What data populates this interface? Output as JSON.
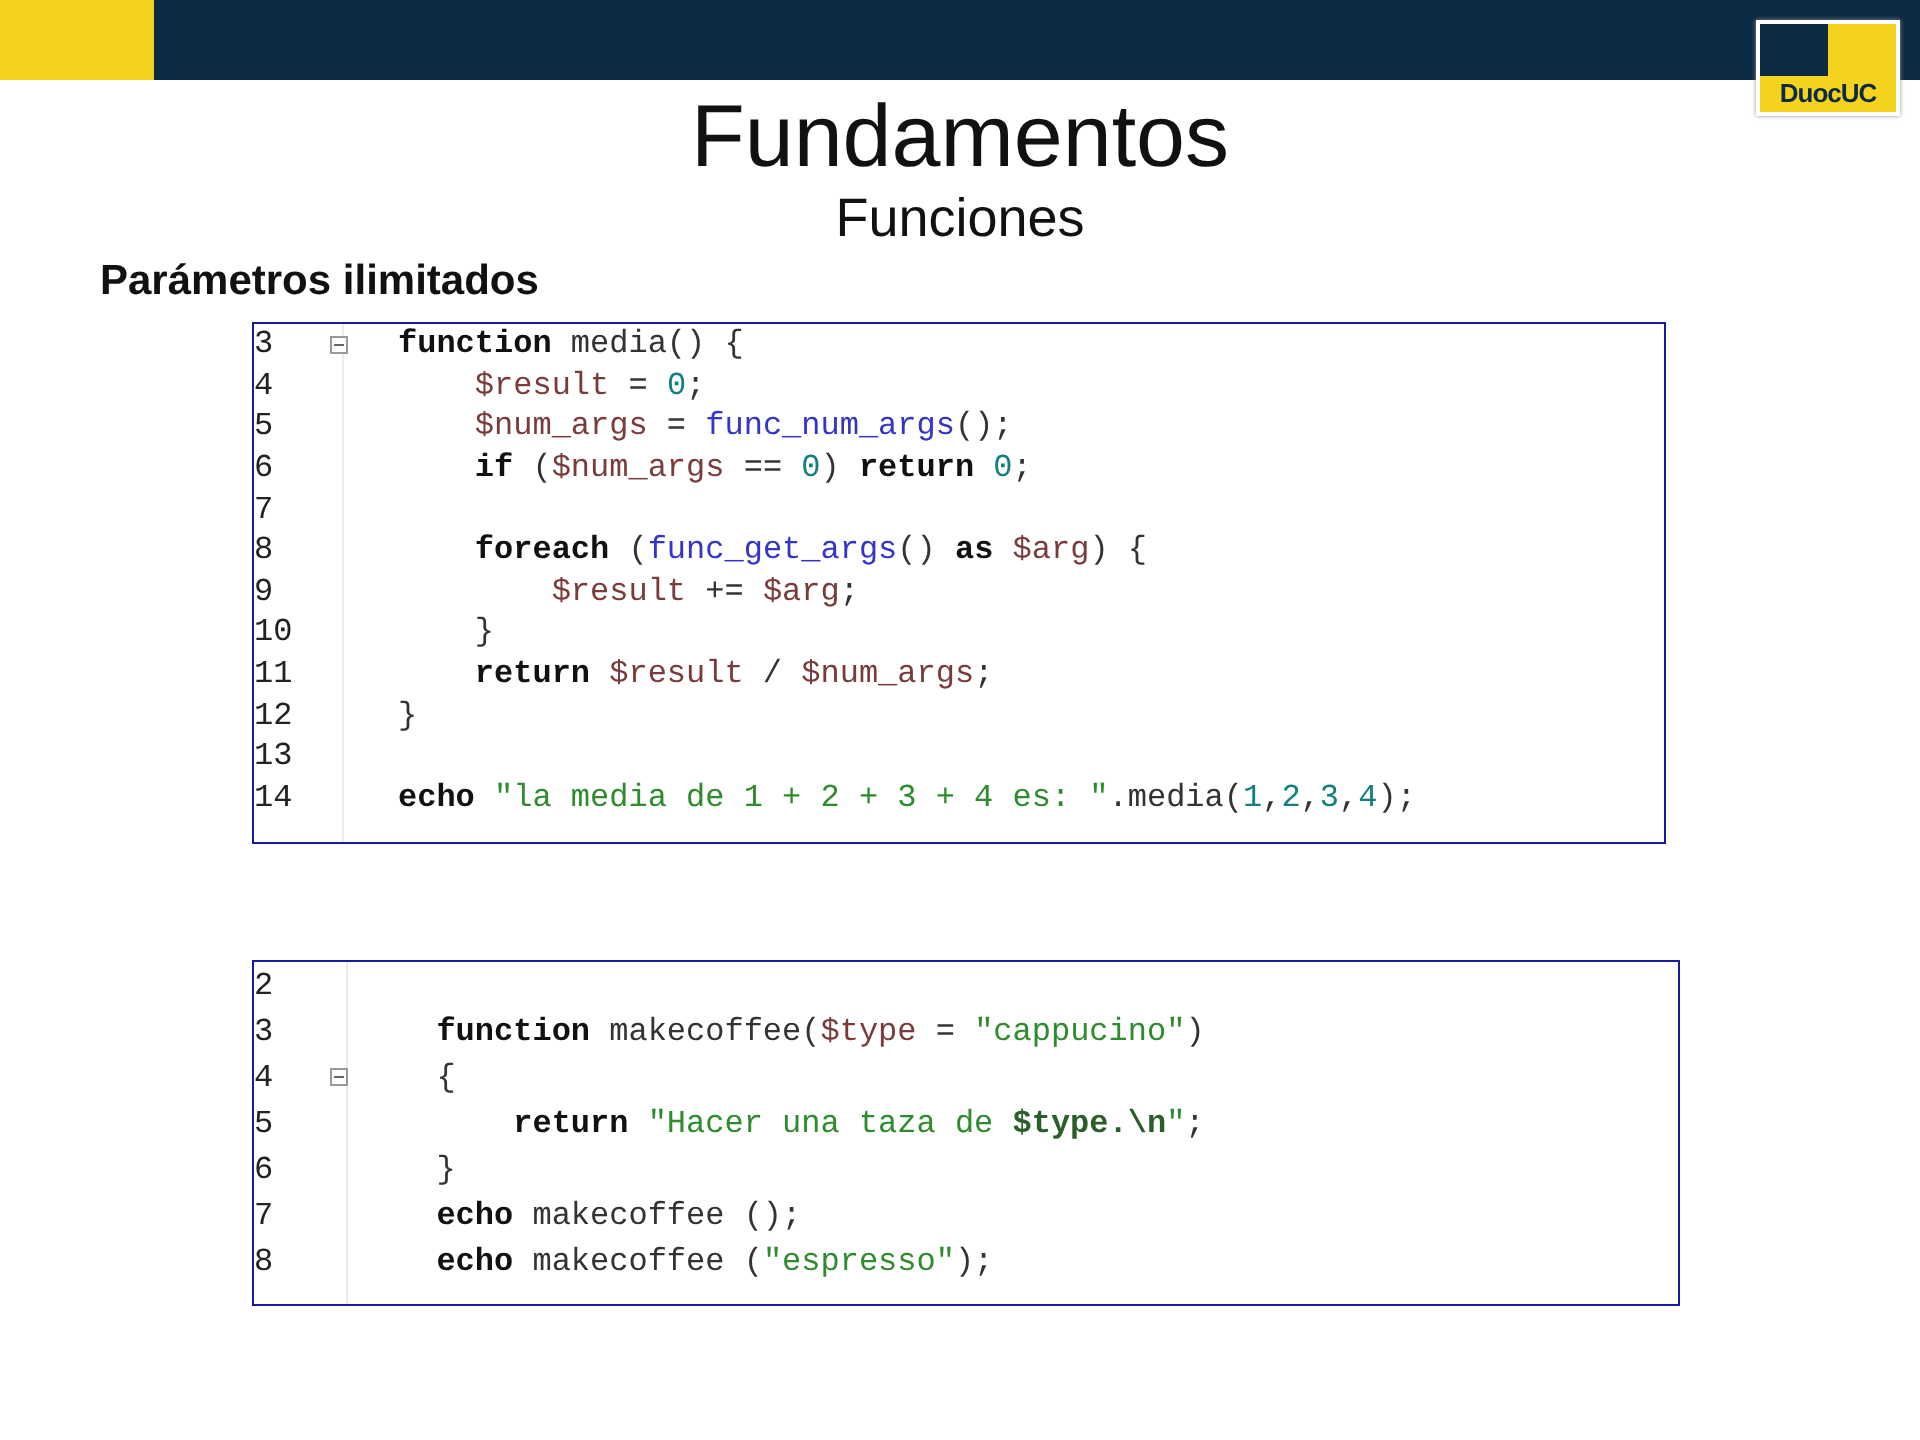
{
  "logo": {
    "text": "DuocUC"
  },
  "title": "Fundamentos",
  "subtitle": "Funciones",
  "section_heading": "Parámetros ilimitados",
  "code_blocks": [
    {
      "lines": [
        {
          "number": "3",
          "fold_marker": true,
          "tokens": [
            {
              "kind": "keyword",
              "text": "function"
            },
            {
              "kind": "plain",
              "text": " media() {"
            }
          ]
        },
        {
          "number": "4",
          "fold_marker": false,
          "tokens": [
            {
              "kind": "variable",
              "text": "    $result"
            },
            {
              "kind": "plain",
              "text": " = "
            },
            {
              "kind": "number",
              "text": "0"
            },
            {
              "kind": "plain",
              "text": ";"
            }
          ]
        },
        {
          "number": "5",
          "fold_marker": false,
          "tokens": [
            {
              "kind": "variable",
              "text": "    $num_args"
            },
            {
              "kind": "plain",
              "text": " = "
            },
            {
              "kind": "builtin",
              "text": "func_num_args"
            },
            {
              "kind": "plain",
              "text": "();"
            }
          ]
        },
        {
          "number": "6",
          "fold_marker": false,
          "tokens": [
            {
              "kind": "keyword",
              "text": "    if"
            },
            {
              "kind": "plain",
              "text": " ("
            },
            {
              "kind": "variable",
              "text": "$num_args"
            },
            {
              "kind": "plain",
              "text": " == "
            },
            {
              "kind": "number",
              "text": "0"
            },
            {
              "kind": "plain",
              "text": ") "
            },
            {
              "kind": "keyword",
              "text": "return"
            },
            {
              "kind": "number",
              "text": " 0"
            },
            {
              "kind": "plain",
              "text": ";"
            }
          ]
        },
        {
          "number": "7",
          "fold_marker": false
        },
        {
          "number": "8",
          "fold_marker": false,
          "tokens": [
            {
              "kind": "keyword",
              "text": "    foreach"
            },
            {
              "kind": "plain",
              "text": " ("
            },
            {
              "kind": "builtin",
              "text": "func_get_args"
            },
            {
              "kind": "plain",
              "text": "() "
            },
            {
              "kind": "keyword",
              "text": "as"
            },
            {
              "kind": "variable",
              "text": " $arg"
            },
            {
              "kind": "plain",
              "text": ") {"
            }
          ]
        },
        {
          "number": "9",
          "fold_marker": false,
          "tokens": [
            {
              "kind": "variable",
              "text": "        $result"
            },
            {
              "kind": "plain",
              "text": " += "
            },
            {
              "kind": "variable",
              "text": "$arg"
            },
            {
              "kind": "plain",
              "text": ";"
            }
          ]
        },
        {
          "number": "10",
          "fold_marker": false,
          "tokens": [
            {
              "kind": "plain",
              "text": "    }"
            }
          ]
        },
        {
          "number": "11",
          "fold_marker": false,
          "tokens": [
            {
              "kind": "keyword",
              "text": "    return"
            },
            {
              "kind": "variable",
              "text": " $result"
            },
            {
              "kind": "plain",
              "text": " / "
            },
            {
              "kind": "variable",
              "text": "$num_args"
            },
            {
              "kind": "plain",
              "text": ";"
            }
          ]
        },
        {
          "number": "12",
          "fold_marker": false,
          "tokens": [
            {
              "kind": "plain",
              "text": "}"
            }
          ]
        },
        {
          "number": "13",
          "fold_marker": false
        },
        {
          "number": "14",
          "fold_marker": false,
          "tokens": [
            {
              "kind": "keyword",
              "text": "echo"
            },
            {
              "kind": "string",
              "text": " \"la media de 1 + 2 + 3 + 4 es: \""
            },
            {
              "kind": "plain",
              "text": ".media("
            },
            {
              "kind": "number",
              "text": "1"
            },
            {
              "kind": "plain",
              "text": ","
            },
            {
              "kind": "number",
              "text": "2"
            },
            {
              "kind": "plain",
              "text": ","
            },
            {
              "kind": "number",
              "text": "3"
            },
            {
              "kind": "plain",
              "text": ","
            },
            {
              "kind": "number",
              "text": "4"
            },
            {
              "kind": "plain",
              "text": ");"
            }
          ]
        }
      ]
    },
    {
      "lines": [
        {
          "number": "2",
          "fold_marker": false
        },
        {
          "number": "3",
          "fold_marker": false,
          "tokens": [
            {
              "kind": "keyword",
              "text": "  function"
            },
            {
              "kind": "plain",
              "text": " makecoffee("
            },
            {
              "kind": "variable",
              "text": "$type"
            },
            {
              "kind": "plain",
              "text": " = "
            },
            {
              "kind": "string",
              "text": "\"cappucino\""
            },
            {
              "kind": "plain",
              "text": ")"
            }
          ]
        },
        {
          "number": "4",
          "fold_marker": true,
          "tokens": [
            {
              "kind": "plain",
              "text": "  {"
            }
          ]
        },
        {
          "number": "5",
          "fold_marker": false,
          "tokens": [
            {
              "kind": "keyword",
              "text": "      return"
            },
            {
              "kind": "string",
              "text": " \"Hacer una taza de "
            },
            {
              "kind": "interp",
              "text": "$type.\\n"
            },
            {
              "kind": "string",
              "text": "\""
            },
            {
              "kind": "plain",
              "text": ";"
            }
          ]
        },
        {
          "number": "6",
          "fold_marker": false,
          "tokens": [
            {
              "kind": "plain",
              "text": "  }"
            }
          ]
        },
        {
          "number": "7",
          "fold_marker": false,
          "tokens": [
            {
              "kind": "keyword",
              "text": "  echo"
            },
            {
              "kind": "plain",
              "text": " makecoffee ();"
            }
          ]
        },
        {
          "number": "8",
          "fold_marker": false,
          "tokens": [
            {
              "kind": "keyword",
              "text": "  echo"
            },
            {
              "kind": "plain",
              "text": " makecoffee ("
            },
            {
              "kind": "string",
              "text": "\"espresso\""
            },
            {
              "kind": "plain",
              "text": ");"
            }
          ]
        }
      ]
    }
  ]
}
